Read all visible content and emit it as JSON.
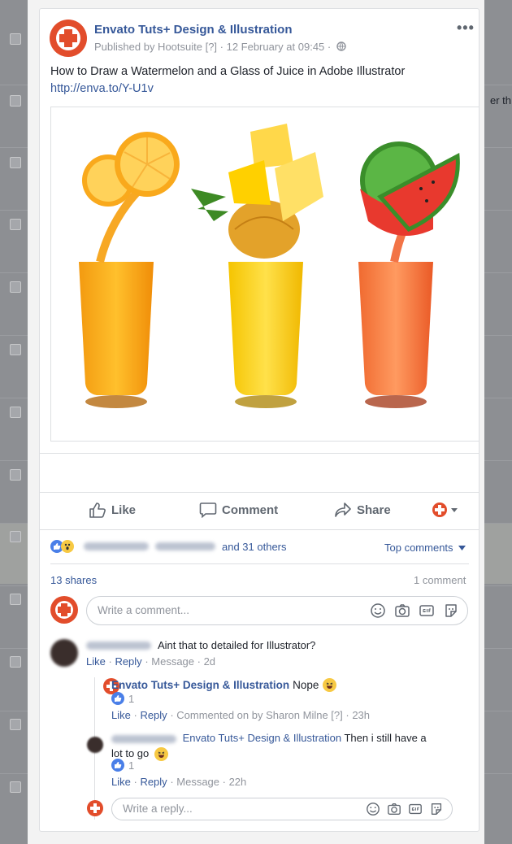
{
  "background": {
    "right_text": "er th"
  },
  "post": {
    "page_name": "Envato Tuts+ Design & Illustration",
    "meta": "Published by Hootsuite [?] · 12 February at 09:45 ·",
    "more": "•••",
    "text": "How to Draw a Watermelon and a Glass of Juice in Adobe Illustrator",
    "link": "http://enva.to/Y-U1v"
  },
  "actions": {
    "like": "Like",
    "comment": "Comment",
    "share": "Share"
  },
  "reactions": {
    "others": "and 31 others",
    "sort": "Top comments"
  },
  "stats": {
    "shares": "13 shares",
    "comments": "1 comment"
  },
  "composer": {
    "placeholder": "Write a comment..."
  },
  "comments": [
    {
      "text": "Aint that to detailed for Illustrator?",
      "actions": {
        "like": "Like",
        "reply": "Reply",
        "rest": "Message · 2d"
      },
      "replies": [
        {
          "author": "Envato Tuts+ Design & Illustration",
          "text": "Nope",
          "count": "1",
          "actions": {
            "like": "Like",
            "reply": "Reply",
            "rest": "Commented on by Sharon Milne [?] · 23h"
          }
        },
        {
          "author": "Envato Tuts+ Design & Illustration",
          "text_line1": "Then i still have a",
          "text_line2": "lot to go",
          "count": "1",
          "actions": {
            "like": "Like",
            "reply": "Reply",
            "rest": "Message · 22h"
          }
        }
      ]
    }
  ],
  "reply_composer": {
    "placeholder": "Write a reply..."
  },
  "colors": {
    "brand": "#e24d2b",
    "link": "#365899",
    "like_blue": "#4a7fe8"
  },
  "icons": [
    "like-icon",
    "comment-icon",
    "share-icon",
    "emoji-icon",
    "camera-icon",
    "gif-icon",
    "sticker-icon",
    "globe-icon"
  ]
}
